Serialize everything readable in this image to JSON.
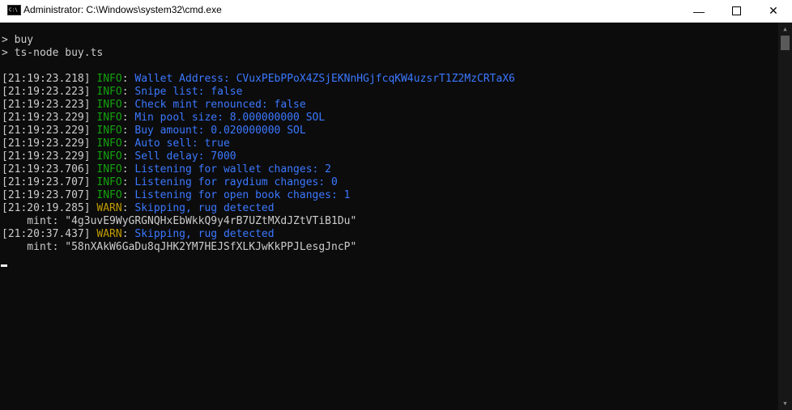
{
  "window": {
    "title": "Administrator:  C:\\Windows\\system32\\cmd.exe",
    "icon_text": "C:\\"
  },
  "commands": [
    {
      "prompt": ">",
      "text": " buy"
    },
    {
      "prompt": ">",
      "text": " ts-node buy.ts"
    }
  ],
  "logs": [
    {
      "ts": "[21:19:23.218]",
      "level": "INFO",
      "msg": "Wallet Address: CVuxPEbPPoX4ZSjEKNnHGjfcqKW4uzsrT1Z2MzCRTaX6"
    },
    {
      "ts": "[21:19:23.223]",
      "level": "INFO",
      "msg": "Snipe list: false"
    },
    {
      "ts": "[21:19:23.223]",
      "level": "INFO",
      "msg": "Check mint renounced: false"
    },
    {
      "ts": "[21:19:23.229]",
      "level": "INFO",
      "msg": "Min pool size: 8.000000000 SOL"
    },
    {
      "ts": "[21:19:23.229]",
      "level": "INFO",
      "msg": "Buy amount: 0.020000000 SOL"
    },
    {
      "ts": "[21:19:23.229]",
      "level": "INFO",
      "msg": "Auto sell: true"
    },
    {
      "ts": "[21:19:23.229]",
      "level": "INFO",
      "msg": "Sell delay: 7000"
    },
    {
      "ts": "[21:19:23.706]",
      "level": "INFO",
      "msg": "Listening for wallet changes: 2"
    },
    {
      "ts": "[21:19:23.707]",
      "level": "INFO",
      "msg": "Listening for raydium changes: 0"
    },
    {
      "ts": "[21:19:23.707]",
      "level": "INFO",
      "msg": "Listening for open book changes: 1"
    },
    {
      "ts": "[21:20:19.285]",
      "level": "WARN",
      "msg": "Skipping, rug detected",
      "extra": "    mint: \"4g3uvE9WyGRGNQHxEbWkkQ9y4rB7UZtMXdJZtVTiB1Du\""
    },
    {
      "ts": "[21:20:37.437]",
      "level": "WARN",
      "msg": "Skipping, rug detected",
      "extra": "    mint: \"58nXAkW6GaDu8qJHK2YM7HEJSfXLKJwKkPPJLesgJncP\""
    }
  ],
  "colors": {
    "info": "#13a10e",
    "warn": "#c19c00",
    "message": "#3b78ff",
    "text": "#cccccc",
    "background": "#0c0c0c"
  }
}
